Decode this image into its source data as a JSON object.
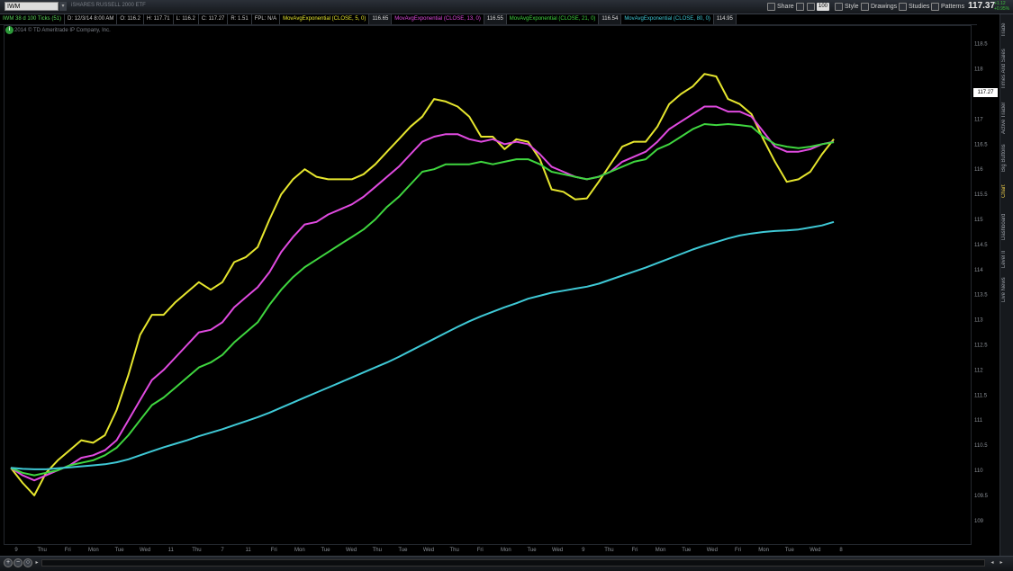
{
  "toolbar": {
    "symbol": "IWM",
    "symbol_desc": "iSHARES RUSSELL 2000 ETF",
    "share": "Share",
    "badge": "100",
    "style": "Style",
    "drawings": "Drawings",
    "studies": "Studies",
    "patterns": "Patterns",
    "last_price": "117.37",
    "change_top": "+1.12",
    "change_bottom": "+0.95%"
  },
  "infobar": {
    "chart_spec": "IWM 38 d 100 Ticks (51)",
    "date": "D: 12/3/14 8:00 AM",
    "open": "O: 116.2",
    "high": "H: 117.71",
    "low": "L: 116.2",
    "close": "C: 117.27",
    "range": "R: 1.51",
    "fpl": "FPL: N/A",
    "study1_label": "MovAvgExponential (CLOSE, 5, 0)",
    "study1_value": "116.65",
    "study2_label": "MovAvgExponential (CLOSE, 13, 0)",
    "study2_value": "116.55",
    "study3_label": "MovAvgExponential (CLOSE, 21, 0)",
    "study3_value": "116.54",
    "study4_label": "MovAvgExponential (CLOSE, 80, 0)",
    "study4_value": "114.95"
  },
  "copyright": "2014 © TD Ameritrade IP Company, Inc.",
  "info_icon": "info-icon",
  "side_tabs": [
    "Trade",
    "Times And Sales",
    "Active Trader",
    "Big Buttons",
    "Chart",
    "Dashboard",
    "Level II",
    "Live News"
  ],
  "active_tab": "Chart",
  "current_price_tag": "117.27",
  "chart_data": {
    "type": "line",
    "ylim": [
      108.8,
      118.8
    ],
    "y_ticks": [
      109,
      109.5,
      110,
      110.5,
      111,
      111.5,
      112,
      112.5,
      113,
      113.5,
      114,
      114.5,
      115,
      115.5,
      116,
      116.5,
      117,
      117.5,
      118,
      118.5
    ],
    "x_labels": [
      "9",
      "Thu",
      "Fri",
      "Mon",
      "Tue",
      "Wed",
      "11",
      "Thu",
      "7",
      "11",
      "Fri",
      "Mon",
      "Tue",
      "Wed",
      "Thu",
      "Tue",
      "Wed",
      "Thu",
      "Fri",
      "Mon",
      "Tue",
      "Wed",
      "9",
      "Thu",
      "Fri",
      "Mon",
      "Tue",
      "Wed",
      "Fri",
      "Mon",
      "Tue",
      "Wed",
      "8"
    ],
    "x": [
      0,
      1,
      2,
      3,
      4,
      5,
      6,
      7,
      8,
      9,
      10,
      11,
      12,
      13,
      14,
      15,
      16,
      17,
      18,
      19,
      20,
      21,
      22,
      23,
      24,
      25,
      26,
      27,
      28,
      29,
      30,
      31,
      32,
      33,
      34,
      35,
      36,
      37,
      38,
      39,
      40,
      41,
      42,
      43,
      44,
      45,
      46,
      47,
      48,
      49,
      50,
      51,
      52,
      53,
      54,
      55,
      56,
      57,
      58,
      59,
      60,
      61,
      62,
      63,
      64,
      65,
      66,
      67,
      68,
      69,
      70,
      71,
      72,
      73,
      74,
      75,
      76,
      77,
      78,
      79,
      80,
      81,
      82,
      83,
      84,
      85,
      86,
      87,
      88,
      89
    ],
    "series": [
      {
        "name": "MovAvgExponential (CLOSE, 5, 0)",
        "color": "#e6e62e",
        "values": [
          110.05,
          109.75,
          109.5,
          109.95,
          110.2,
          110.4,
          110.6,
          110.55,
          110.7,
          111.2,
          111.9,
          112.7,
          113.1,
          113.1,
          113.35,
          113.55,
          113.75,
          113.6,
          113.75,
          114.15,
          114.25,
          114.45,
          115.0,
          115.5,
          115.8,
          116.0,
          115.85,
          115.8,
          115.8,
          115.8,
          115.9,
          116.1,
          116.35,
          116.6,
          116.85,
          117.05,
          117.4,
          117.35,
          117.25,
          117.05,
          116.65,
          116.65,
          116.4,
          116.6,
          116.55,
          116.2,
          115.6,
          115.55,
          115.4,
          115.42,
          115.75,
          116.1,
          116.45,
          116.55,
          116.55,
          116.85,
          117.3,
          117.5,
          117.65,
          117.9,
          117.85,
          117.4,
          117.3,
          117.1,
          116.6,
          116.15,
          115.75,
          115.8,
          115.95,
          116.3,
          116.6
        ]
      },
      {
        "name": "MovAvgExponential (CLOSE, 13, 0)",
        "color": "#e04ae0",
        "values": [
          110.05,
          109.9,
          109.8,
          109.9,
          110.0,
          110.1,
          110.25,
          110.3,
          110.4,
          110.6,
          111.0,
          111.4,
          111.8,
          112.0,
          112.25,
          112.5,
          112.75,
          112.8,
          112.95,
          113.25,
          113.45,
          113.65,
          113.95,
          114.35,
          114.65,
          114.9,
          114.95,
          115.1,
          115.2,
          115.3,
          115.45,
          115.65,
          115.85,
          116.05,
          116.3,
          116.55,
          116.65,
          116.7,
          116.7,
          116.6,
          116.55,
          116.6,
          116.5,
          116.55,
          116.5,
          116.3,
          116.05,
          115.95,
          115.85,
          115.8,
          115.85,
          115.95,
          116.15,
          116.25,
          116.35,
          116.55,
          116.8,
          116.95,
          117.1,
          117.25,
          117.25,
          117.15,
          117.15,
          117.05,
          116.75,
          116.45,
          116.35,
          116.35,
          116.4,
          116.5,
          116.55
        ]
      },
      {
        "name": "MovAvgExponential (CLOSE, 21, 0)",
        "color": "#3fd63f",
        "values": [
          110.05,
          109.95,
          109.9,
          109.95,
          110.0,
          110.1,
          110.15,
          110.2,
          110.3,
          110.45,
          110.7,
          111.0,
          111.3,
          111.45,
          111.65,
          111.85,
          112.05,
          112.15,
          112.3,
          112.55,
          112.75,
          112.95,
          113.3,
          113.6,
          113.85,
          114.05,
          114.2,
          114.35,
          114.5,
          114.65,
          114.8,
          115.0,
          115.25,
          115.45,
          115.7,
          115.95,
          116.0,
          116.1,
          116.1,
          116.1,
          116.15,
          116.1,
          116.15,
          116.2,
          116.2,
          116.1,
          115.95,
          115.9,
          115.85,
          115.8,
          115.85,
          115.95,
          116.05,
          116.15,
          116.2,
          116.4,
          116.5,
          116.65,
          116.8,
          116.9,
          116.88,
          116.9,
          116.88,
          116.85,
          116.65,
          116.5,
          116.45,
          116.42,
          116.45,
          116.5,
          116.54
        ]
      },
      {
        "name": "MovAvgExponential (CLOSE, 80, 0)",
        "color": "#3fc9d6",
        "values": [
          110.05,
          110.03,
          110.02,
          110.02,
          110.04,
          110.06,
          110.08,
          110.1,
          110.12,
          110.16,
          110.22,
          110.3,
          110.38,
          110.46,
          110.53,
          110.6,
          110.68,
          110.75,
          110.82,
          110.9,
          110.98,
          111.06,
          111.15,
          111.25,
          111.35,
          111.45,
          111.55,
          111.65,
          111.75,
          111.85,
          111.95,
          112.05,
          112.15,
          112.26,
          112.38,
          112.5,
          112.62,
          112.74,
          112.86,
          112.97,
          113.07,
          113.16,
          113.25,
          113.33,
          113.42,
          113.48,
          113.54,
          113.58,
          113.62,
          113.66,
          113.72,
          113.8,
          113.88,
          113.96,
          114.04,
          114.13,
          114.22,
          114.31,
          114.4,
          114.48,
          114.55,
          114.62,
          114.68,
          114.72,
          114.75,
          114.77,
          114.78,
          114.8,
          114.84,
          114.88,
          114.95
        ]
      }
    ]
  }
}
